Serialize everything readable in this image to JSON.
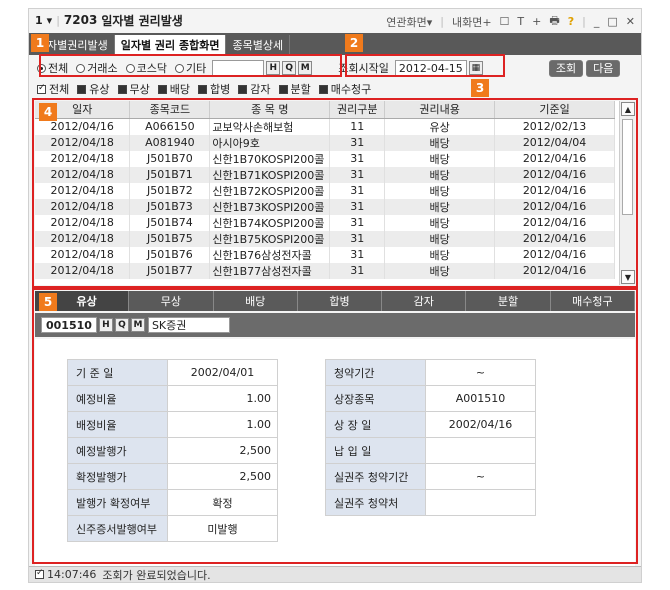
{
  "title": {
    "num": "1",
    "arrow": "▾",
    "code": "7203",
    "name": "일자별 권리발생",
    "menu1": "연관화면",
    "menu2": "내화면",
    "icons": [
      "☐",
      "T",
      "+",
      "🖶",
      "?"
    ],
    "winctl": [
      "_",
      "□",
      "✕"
    ]
  },
  "tabs": [
    "자별권리발생",
    "일자별 권리 종합화면",
    "종목별상세"
  ],
  "badges": [
    "1",
    "2",
    "3",
    "4",
    "5"
  ],
  "market_filter": {
    "options": [
      "전체",
      "거래소",
      "코스닥",
      "기타"
    ],
    "selected": "전체",
    "search_buttons": [
      "H",
      "Q",
      "M"
    ]
  },
  "query": {
    "label": "조회시작일",
    "date": "2012-04-15",
    "search_label": "조회",
    "next_label": "다음"
  },
  "rights_filter": [
    "전체",
    "유상",
    "무상",
    "배당",
    "합병",
    "감자",
    "분할",
    "매수청구"
  ],
  "grid": {
    "columns": [
      "일자",
      "종목코드",
      "종 목 명",
      "권리구분",
      "권리내용",
      "기준일"
    ],
    "rows": [
      [
        "2012/04/16",
        "A066150",
        "교보악사손해보험",
        "11",
        "유상",
        "2012/02/13"
      ],
      [
        "2012/04/18",
        "A081940",
        "아시아9호",
        "31",
        "배당",
        "2012/04/04"
      ],
      [
        "2012/04/18",
        "J501B70",
        "신한1B70KOSPI200콜",
        "31",
        "배당",
        "2012/04/16"
      ],
      [
        "2012/04/18",
        "J501B71",
        "신한1B71KOSPI200콜",
        "31",
        "배당",
        "2012/04/16"
      ],
      [
        "2012/04/18",
        "J501B72",
        "신한1B72KOSPI200콜",
        "31",
        "배당",
        "2012/04/16"
      ],
      [
        "2012/04/18",
        "J501B73",
        "신한1B73KOSPI200콜",
        "31",
        "배당",
        "2012/04/16"
      ],
      [
        "2012/04/18",
        "J501B74",
        "신한1B74KOSPI200콜",
        "31",
        "배당",
        "2012/04/16"
      ],
      [
        "2012/04/18",
        "J501B75",
        "신한1B75KOSPI200콜",
        "31",
        "배당",
        "2012/04/16"
      ],
      [
        "2012/04/18",
        "J501B76",
        "신한1B76삼성전자콜",
        "31",
        "배당",
        "2012/04/16"
      ],
      [
        "2012/04/18",
        "J501B77",
        "신한1B77삼성전자콜",
        "31",
        "배당",
        "2012/04/16"
      ]
    ]
  },
  "subtabs": [
    "유상",
    "무상",
    "배당",
    "합병",
    "감자",
    "분할",
    "매수청구"
  ],
  "stock": {
    "code": "001510",
    "name": "SK증권"
  },
  "detail_left": [
    {
      "label": "기 준 일",
      "value": "2002/04/01"
    },
    {
      "label": "예정비율",
      "value": "1.00"
    },
    {
      "label": "배정비율",
      "value": "1.00"
    },
    {
      "label": "예정발행가",
      "value": "2,500"
    },
    {
      "label": "확정발행가",
      "value": "2,500"
    },
    {
      "label": "발행가 확정여부",
      "value": "확정"
    },
    {
      "label": "신주증서발행여부",
      "value": "미발행"
    }
  ],
  "detail_right": [
    {
      "label": "청약기간",
      "value": "~"
    },
    {
      "label": "상장종목",
      "value": "A001510"
    },
    {
      "label": "상 장 일",
      "value": "2002/04/16"
    },
    {
      "label": "납 입 일",
      "value": ""
    },
    {
      "label": "실권주 청약기간",
      "value": "~"
    },
    {
      "label": "실권주 청약처",
      "value": ""
    }
  ],
  "status": {
    "time": "14:07:46",
    "message": "조회가 완료되었습니다."
  }
}
